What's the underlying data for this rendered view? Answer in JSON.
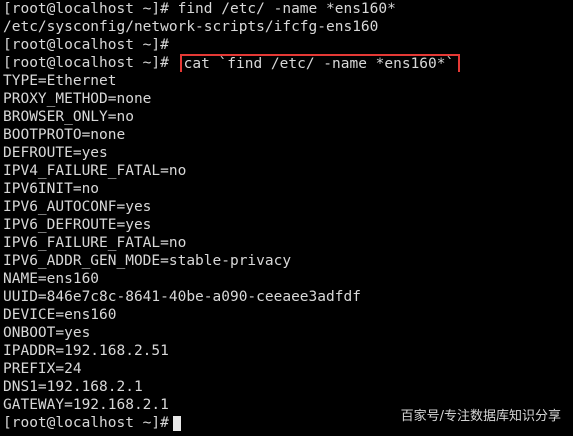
{
  "terminal": {
    "prompt": "[root@localhost ~]# ",
    "lines": [
      "[root@localhost ~]# find /etc/ -name *ens160*",
      "/etc/sysconfig/network-scripts/ifcfg-ens160",
      "[root@localhost ~]#"
    ],
    "highlighted_command": "cat `find /etc/ -name *ens160*`",
    "output": [
      "TYPE=Ethernet",
      "PROXY_METHOD=none",
      "BROWSER_ONLY=no",
      "BOOTPROTO=none",
      "DEFROUTE=yes",
      "IPV4_FAILURE_FATAL=no",
      "IPV6INIT=no",
      "IPV6_AUTOCONF=yes",
      "IPV6_DEFROUTE=yes",
      "IPV6_FAILURE_FATAL=no",
      "IPV6_ADDR_GEN_MODE=stable-privacy",
      "NAME=ens160",
      "UUID=846e7c8c-8641-40be-a090-ceeaee3adfdf",
      "DEVICE=ens160",
      "ONBOOT=yes",
      "IPADDR=192.168.2.51",
      "PREFIX=24",
      "DNS1=192.168.2.1",
      "GATEWAY=192.168.2.1"
    ],
    "final_prompt": "[root@localhost ~]#"
  },
  "watermark": "百家号/专注数据库知识分享",
  "colors": {
    "background": "#000000",
    "text": "#d8d8d8",
    "highlight_border": "#e53935"
  }
}
